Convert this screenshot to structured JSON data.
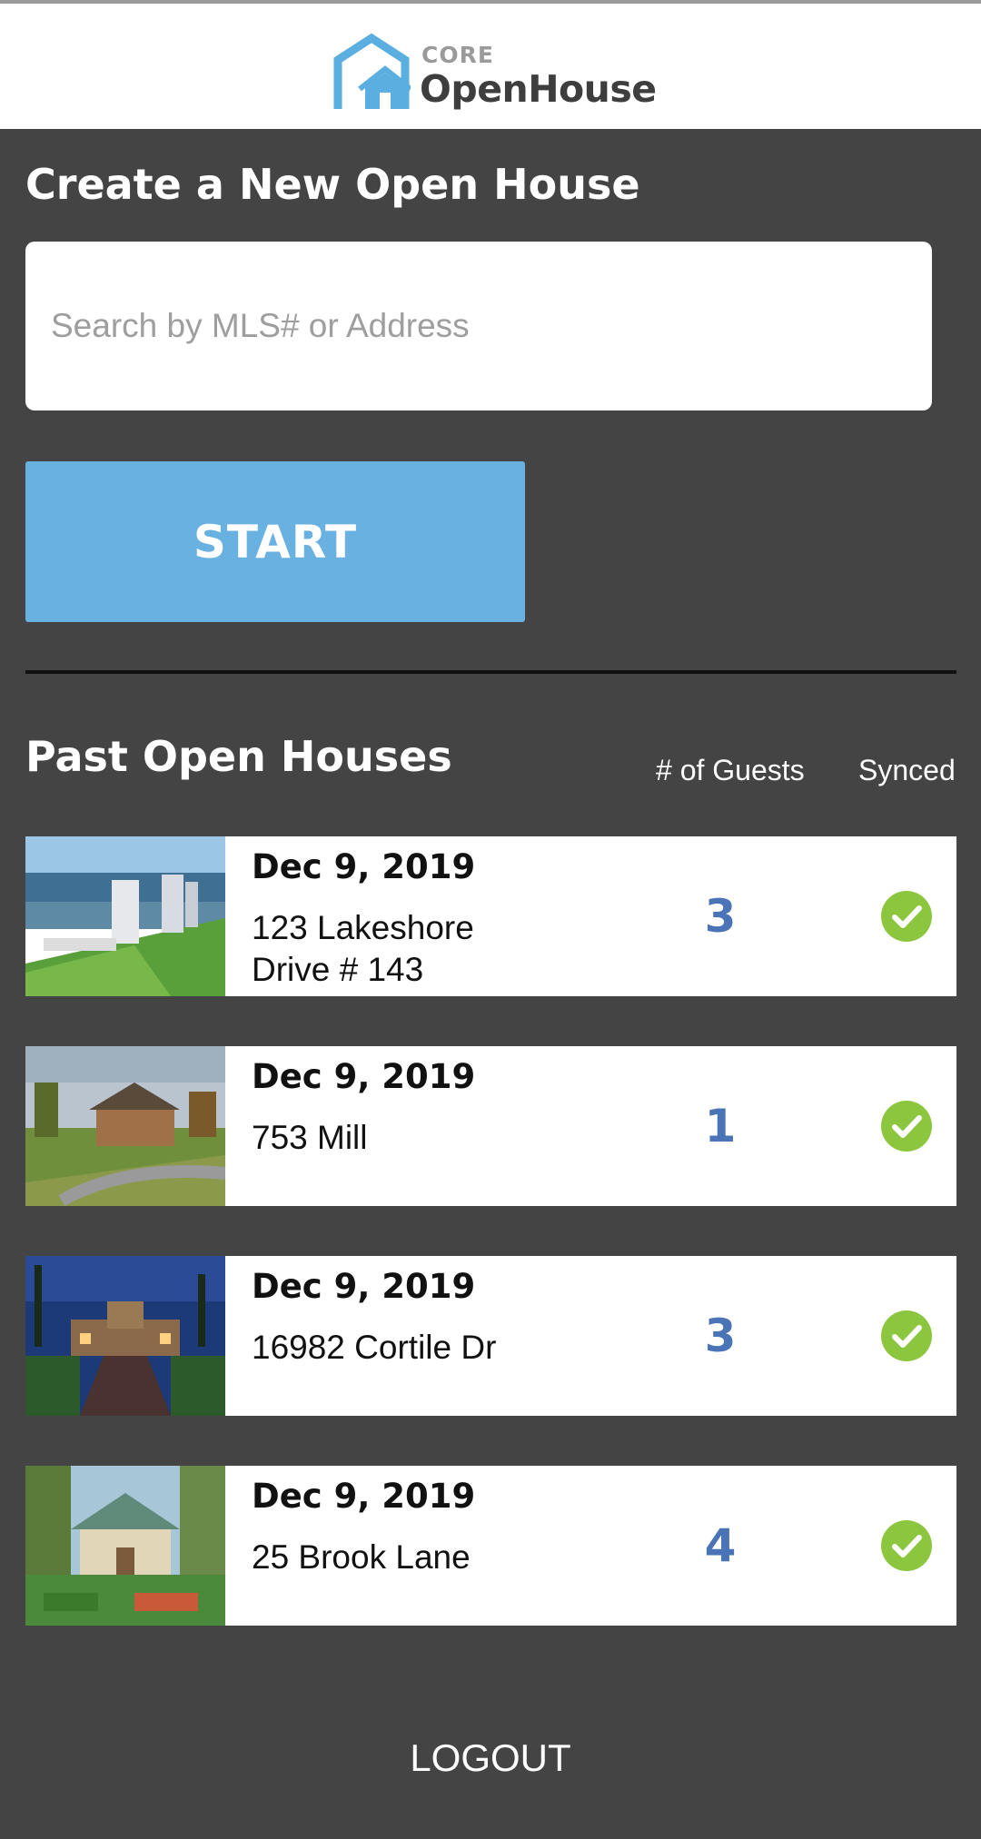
{
  "header": {
    "logo_small": "CORE",
    "logo_main": "OpenHouse"
  },
  "create": {
    "title": "Create a New Open House",
    "search_placeholder": "Search by MLS# or Address",
    "search_value": "",
    "start_label": "START"
  },
  "past": {
    "title": "Past Open Houses",
    "col_guests": "# of Guests",
    "col_synced": "Synced",
    "rows": [
      {
        "date": "Dec 9, 2019",
        "address": "123 Lakeshore Drive # 143",
        "guests": "3",
        "synced": true,
        "photo": "waterfront-towers"
      },
      {
        "date": "Dec 9, 2019",
        "address": "753 Mill",
        "guests": "1",
        "synced": true,
        "photo": "country-cabin"
      },
      {
        "date": "Dec 9, 2019",
        "address": "16982 Cortile Dr",
        "guests": "3",
        "synced": true,
        "photo": "night-villa"
      },
      {
        "date": "Dec 9, 2019",
        "address": "25 Brook Lane",
        "guests": "4",
        "synced": true,
        "photo": "garden-cottage"
      }
    ]
  },
  "footer": {
    "logout_label": "LOGOUT"
  },
  "colors": {
    "background": "#444444",
    "accent_blue": "#69b1e0",
    "guest_count": "#4a74b6",
    "synced_green": "#8cc63f"
  },
  "icons": {
    "logo": "house-outline-icon",
    "synced": "check-circle-icon"
  }
}
